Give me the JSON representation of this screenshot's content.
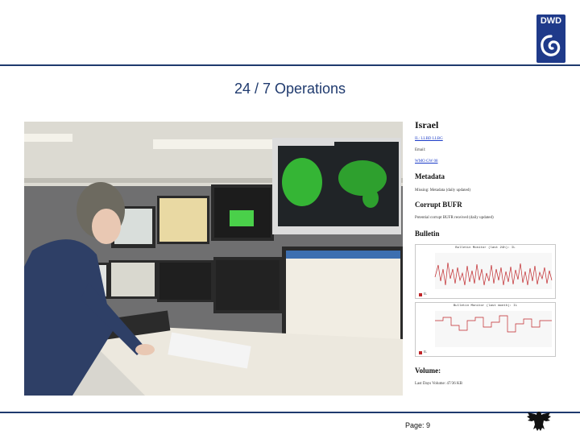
{
  "header": {
    "logo_text": "DWD",
    "title": "24 / 7 Operations"
  },
  "panel": {
    "heading": "Israel",
    "code_link": "IL: LLBD LLBG",
    "email_label": "Email:",
    "wmo_link": "WMO GW 08",
    "metadata_heading": "Metadata",
    "metadata_text": "Missing: Metadata (daily updated)",
    "corrupt_heading": "Corrupt BUFR",
    "corrupt_text": "Potential corrupt BUFR received (daily updated)",
    "bulletin_heading": "Bulletin",
    "chart1_title": "Bulletin Monitor (last 24h): IL",
    "chart2_title": "Bulletin Monitor (last month): IL",
    "legend1": "IL",
    "legend2": "IL",
    "volume_heading": "Volume:",
    "volume_text": "Last Days Volume: 47/36 KB"
  },
  "footer": {
    "page_label": "Page: 9"
  },
  "colors": {
    "brand_blue": "#1f3a6e",
    "logo_blue": "#1f3a8a",
    "chart_red": "#c0262a"
  },
  "icons": [
    "dwd-logo-icon",
    "federal-eagle-icon"
  ]
}
